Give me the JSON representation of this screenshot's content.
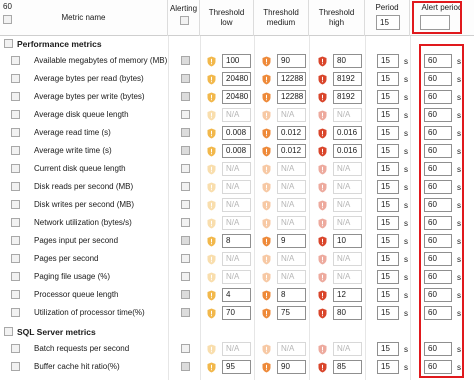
{
  "header": {
    "count": "60",
    "metric_name": "Metric name",
    "alerting": "Alerting",
    "threshold_low": "Threshold low",
    "threshold_medium": "Threshold medium",
    "threshold_high": "Threshold high",
    "period": "Period",
    "period_value": "15",
    "alert_period": "Alert period",
    "alert_period_value": ""
  },
  "sections": [
    {
      "title": "Performance metrics",
      "rows": [
        {
          "name": "Available megabytes of memory (MB)",
          "alerting": true,
          "low": "100",
          "medium": "90",
          "high": "80",
          "period": "15",
          "alert_period": "60"
        },
        {
          "name": "Average bytes per read (bytes)",
          "alerting": true,
          "low": "20480",
          "medium": "12288",
          "high": "8192",
          "period": "15",
          "alert_period": "60"
        },
        {
          "name": "Average bytes per write (bytes)",
          "alerting": true,
          "low": "20480",
          "medium": "12288",
          "high": "8192",
          "period": "15",
          "alert_period": "60"
        },
        {
          "name": "Average disk queue length",
          "alerting": false,
          "low": "N/A",
          "medium": "N/A",
          "high": "N/A",
          "period": "15",
          "alert_period": "60"
        },
        {
          "name": "Average read time (s)",
          "alerting": true,
          "low": "0.008",
          "medium": "0.012",
          "high": "0.016",
          "period": "15",
          "alert_period": "60"
        },
        {
          "name": "Average write time (s)",
          "alerting": true,
          "low": "0.008",
          "medium": "0.012",
          "high": "0.016",
          "period": "15",
          "alert_period": "60"
        },
        {
          "name": "Current disk queue length",
          "alerting": false,
          "low": "N/A",
          "medium": "N/A",
          "high": "N/A",
          "period": "15",
          "alert_period": "60"
        },
        {
          "name": "Disk reads per second  (MB)",
          "alerting": false,
          "low": "N/A",
          "medium": "N/A",
          "high": "N/A",
          "period": "15",
          "alert_period": "60"
        },
        {
          "name": "Disk writes per second (MB)",
          "alerting": false,
          "low": "N/A",
          "medium": "N/A",
          "high": "N/A",
          "period": "15",
          "alert_period": "60"
        },
        {
          "name": "Network utilization (bytes/s)",
          "alerting": false,
          "low": "N/A",
          "medium": "N/A",
          "high": "N/A",
          "period": "15",
          "alert_period": "60"
        },
        {
          "name": "Pages input per second",
          "alerting": true,
          "low": "8",
          "medium": "9",
          "high": "10",
          "period": "15",
          "alert_period": "60"
        },
        {
          "name": "Pages per second",
          "alerting": false,
          "low": "N/A",
          "medium": "N/A",
          "high": "N/A",
          "period": "15",
          "alert_period": "60"
        },
        {
          "name": "Paging file usage (%)",
          "alerting": false,
          "low": "N/A",
          "medium": "N/A",
          "high": "N/A",
          "period": "15",
          "alert_period": "60"
        },
        {
          "name": "Processor queue length",
          "alerting": true,
          "low": "4",
          "medium": "8",
          "high": "12",
          "period": "15",
          "alert_period": "60"
        },
        {
          "name": "Utilization of processor time(%)",
          "alerting": true,
          "low": "70",
          "medium": "75",
          "high": "80",
          "period": "15",
          "alert_period": "60"
        }
      ]
    },
    {
      "title": "SQL Server metrics",
      "rows": [
        {
          "name": "Batch requests per second",
          "alerting": false,
          "low": "N/A",
          "medium": "N/A",
          "high": "N/A",
          "period": "15",
          "alert_period": "60"
        },
        {
          "name": "Buffer cache hit ratio(%)",
          "alerting": true,
          "low": "95",
          "medium": "90",
          "high": "85",
          "period": "15",
          "alert_period": "60"
        }
      ]
    }
  ],
  "units": {
    "alert_period": "s"
  },
  "colors": {
    "shield_low": "#f2b84b",
    "shield_medium": "#ee8a3a",
    "shield_high": "#d9452b",
    "highlight": "#e0191d"
  },
  "icons": {
    "low": "shield-low-icon",
    "medium": "shield-medium-icon",
    "high": "shield-high-icon"
  }
}
